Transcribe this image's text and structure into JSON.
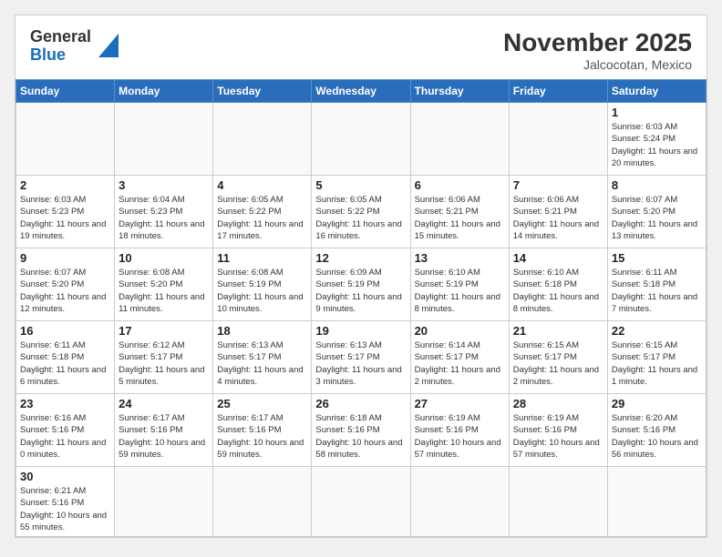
{
  "header": {
    "logo_general": "General",
    "logo_blue": "Blue",
    "month_title": "November 2025",
    "location": "Jalcocotan, Mexico"
  },
  "days_of_week": [
    "Sunday",
    "Monday",
    "Tuesday",
    "Wednesday",
    "Thursday",
    "Friday",
    "Saturday"
  ],
  "weeks": [
    [
      {
        "day": "",
        "info": ""
      },
      {
        "day": "",
        "info": ""
      },
      {
        "day": "",
        "info": ""
      },
      {
        "day": "",
        "info": ""
      },
      {
        "day": "",
        "info": ""
      },
      {
        "day": "",
        "info": ""
      },
      {
        "day": "1",
        "info": "Sunrise: 6:03 AM\nSunset: 5:24 PM\nDaylight: 11 hours and 20 minutes."
      }
    ],
    [
      {
        "day": "2",
        "info": "Sunrise: 6:03 AM\nSunset: 5:23 PM\nDaylight: 11 hours and 19 minutes."
      },
      {
        "day": "3",
        "info": "Sunrise: 6:04 AM\nSunset: 5:23 PM\nDaylight: 11 hours and 18 minutes."
      },
      {
        "day": "4",
        "info": "Sunrise: 6:05 AM\nSunset: 5:22 PM\nDaylight: 11 hours and 17 minutes."
      },
      {
        "day": "5",
        "info": "Sunrise: 6:05 AM\nSunset: 5:22 PM\nDaylight: 11 hours and 16 minutes."
      },
      {
        "day": "6",
        "info": "Sunrise: 6:06 AM\nSunset: 5:21 PM\nDaylight: 11 hours and 15 minutes."
      },
      {
        "day": "7",
        "info": "Sunrise: 6:06 AM\nSunset: 5:21 PM\nDaylight: 11 hours and 14 minutes."
      },
      {
        "day": "8",
        "info": "Sunrise: 6:07 AM\nSunset: 5:20 PM\nDaylight: 11 hours and 13 minutes."
      }
    ],
    [
      {
        "day": "9",
        "info": "Sunrise: 6:07 AM\nSunset: 5:20 PM\nDaylight: 11 hours and 12 minutes."
      },
      {
        "day": "10",
        "info": "Sunrise: 6:08 AM\nSunset: 5:20 PM\nDaylight: 11 hours and 11 minutes."
      },
      {
        "day": "11",
        "info": "Sunrise: 6:08 AM\nSunset: 5:19 PM\nDaylight: 11 hours and 10 minutes."
      },
      {
        "day": "12",
        "info": "Sunrise: 6:09 AM\nSunset: 5:19 PM\nDaylight: 11 hours and 9 minutes."
      },
      {
        "day": "13",
        "info": "Sunrise: 6:10 AM\nSunset: 5:19 PM\nDaylight: 11 hours and 8 minutes."
      },
      {
        "day": "14",
        "info": "Sunrise: 6:10 AM\nSunset: 5:18 PM\nDaylight: 11 hours and 8 minutes."
      },
      {
        "day": "15",
        "info": "Sunrise: 6:11 AM\nSunset: 5:18 PM\nDaylight: 11 hours and 7 minutes."
      }
    ],
    [
      {
        "day": "16",
        "info": "Sunrise: 6:11 AM\nSunset: 5:18 PM\nDaylight: 11 hours and 6 minutes."
      },
      {
        "day": "17",
        "info": "Sunrise: 6:12 AM\nSunset: 5:17 PM\nDaylight: 11 hours and 5 minutes."
      },
      {
        "day": "18",
        "info": "Sunrise: 6:13 AM\nSunset: 5:17 PM\nDaylight: 11 hours and 4 minutes."
      },
      {
        "day": "19",
        "info": "Sunrise: 6:13 AM\nSunset: 5:17 PM\nDaylight: 11 hours and 3 minutes."
      },
      {
        "day": "20",
        "info": "Sunrise: 6:14 AM\nSunset: 5:17 PM\nDaylight: 11 hours and 2 minutes."
      },
      {
        "day": "21",
        "info": "Sunrise: 6:15 AM\nSunset: 5:17 PM\nDaylight: 11 hours and 2 minutes."
      },
      {
        "day": "22",
        "info": "Sunrise: 6:15 AM\nSunset: 5:17 PM\nDaylight: 11 hours and 1 minute."
      }
    ],
    [
      {
        "day": "23",
        "info": "Sunrise: 6:16 AM\nSunset: 5:16 PM\nDaylight: 11 hours and 0 minutes."
      },
      {
        "day": "24",
        "info": "Sunrise: 6:17 AM\nSunset: 5:16 PM\nDaylight: 10 hours and 59 minutes."
      },
      {
        "day": "25",
        "info": "Sunrise: 6:17 AM\nSunset: 5:16 PM\nDaylight: 10 hours and 59 minutes."
      },
      {
        "day": "26",
        "info": "Sunrise: 6:18 AM\nSunset: 5:16 PM\nDaylight: 10 hours and 58 minutes."
      },
      {
        "day": "27",
        "info": "Sunrise: 6:19 AM\nSunset: 5:16 PM\nDaylight: 10 hours and 57 minutes."
      },
      {
        "day": "28",
        "info": "Sunrise: 6:19 AM\nSunset: 5:16 PM\nDaylight: 10 hours and 57 minutes."
      },
      {
        "day": "29",
        "info": "Sunrise: 6:20 AM\nSunset: 5:16 PM\nDaylight: 10 hours and 56 minutes."
      }
    ],
    [
      {
        "day": "30",
        "info": "Sunrise: 6:21 AM\nSunset: 5:16 PM\nDaylight: 10 hours and 55 minutes."
      },
      {
        "day": "",
        "info": ""
      },
      {
        "day": "",
        "info": ""
      },
      {
        "day": "",
        "info": ""
      },
      {
        "day": "",
        "info": ""
      },
      {
        "day": "",
        "info": ""
      },
      {
        "day": "",
        "info": ""
      }
    ]
  ]
}
